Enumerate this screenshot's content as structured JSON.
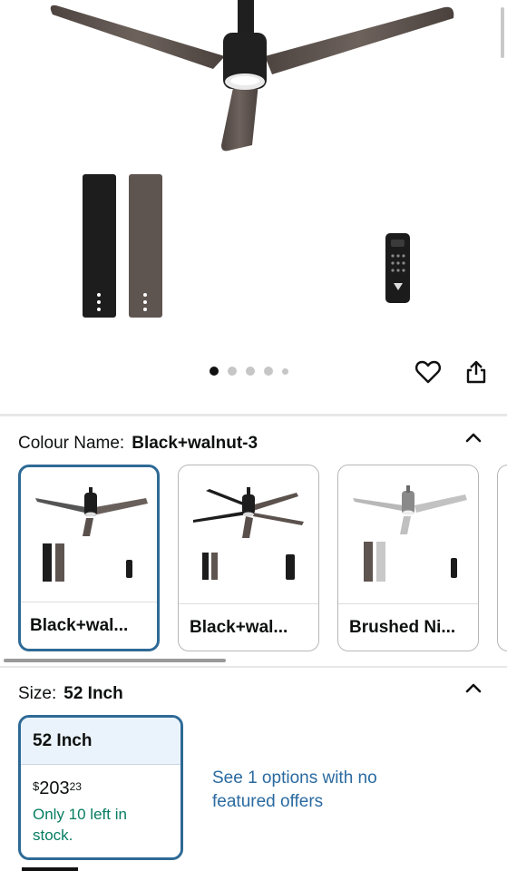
{
  "gallery": {
    "dots_total": 5,
    "dots_active_index": 0
  },
  "icons": {
    "wishlist": "heart-icon",
    "share": "share-icon",
    "collapse": "chevron-up-icon"
  },
  "colour": {
    "label": "Colour Name:",
    "value": "Black+walnut-3",
    "options": [
      {
        "label": "Black+wal..."
      },
      {
        "label": "Black+wal..."
      },
      {
        "label": "Brushed Ni..."
      }
    ]
  },
  "size": {
    "label": "Size:",
    "value": "52 Inch",
    "option": {
      "label": "52 Inch",
      "currency": "$",
      "price_whole": "203",
      "price_fraction": "23",
      "stock": "Only 10 left in stock."
    },
    "offers_link": "See 1 options with no featured offers"
  },
  "colors": {
    "accent_border": "#2e6a96",
    "link": "#2a6aa0",
    "stock_green": "#067d62",
    "selected_header_bg": "#eaf3fb"
  }
}
